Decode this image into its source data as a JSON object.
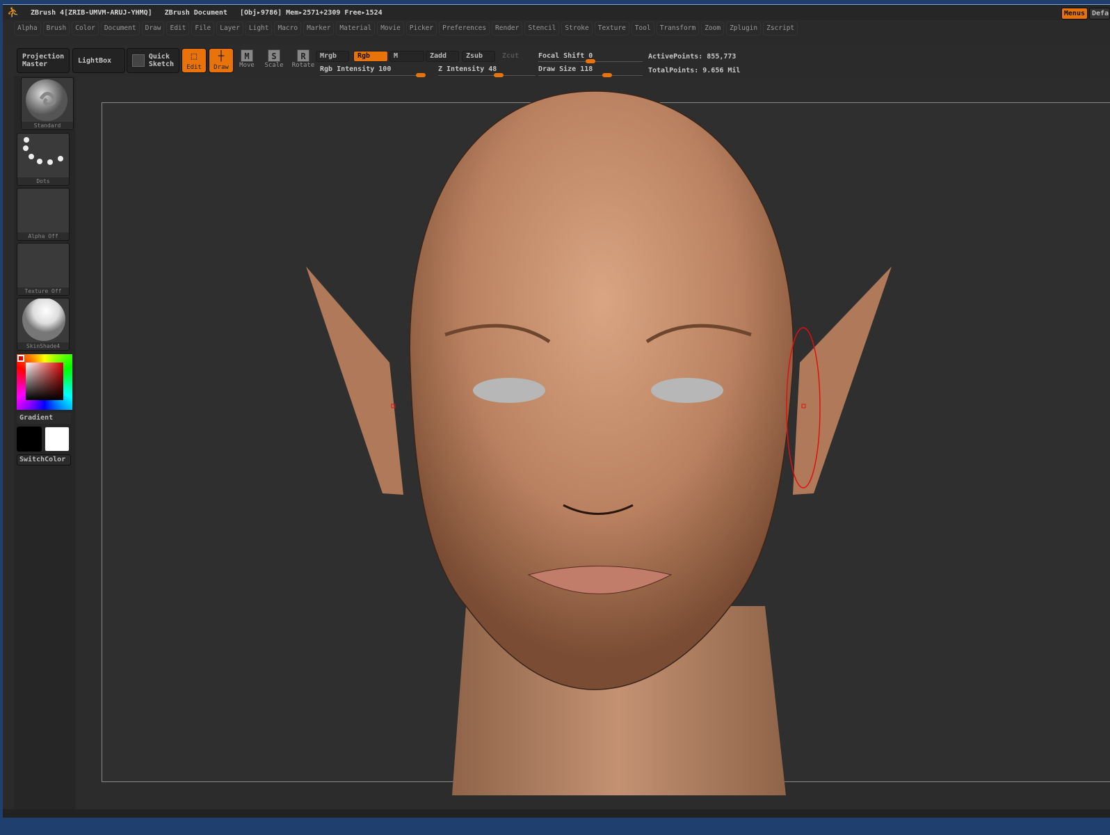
{
  "title": {
    "app": "ZBrush 4[ZRIB-UMVM-ARUJ-YHMQ]",
    "document": "ZBrush Document",
    "stats": "[Obj▸9786] Mem▸2571+2309 Free▸1524"
  },
  "menus": [
    "Alpha",
    "Brush",
    "Color",
    "Document",
    "Draw",
    "Edit",
    "File",
    "Layer",
    "Light",
    "Macro",
    "Marker",
    "Material",
    "Movie",
    "Picker",
    "Preferences",
    "Render",
    "Stencil",
    "Stroke",
    "Texture",
    "Tool",
    "Transform",
    "Zoom",
    "Zplugin",
    "Zscript"
  ],
  "top_right": {
    "menus": "Menus",
    "default": "DefaultZScript"
  },
  "toolbar": {
    "projection_master": [
      "Projection",
      "Master"
    ],
    "lightbox": "LightBox",
    "quick_sketch": [
      "Quick",
      "Sketch"
    ],
    "edit": "Edit",
    "draw": "Draw",
    "move": "Move",
    "scale": "Scale",
    "rotate": "Rotate",
    "mrgb": "Mrgb",
    "rgb": "Rgb",
    "m": "M",
    "zadd": "Zadd",
    "zsub": "Zsub",
    "zcut": "Zcut",
    "rgb_intensity": "Rgb Intensity 100",
    "z_intensity": "Z Intensity 48",
    "focal_shift": "Focal Shift 0",
    "draw_size": "Draw Size 118",
    "active_points": "ActivePoints: 855,773",
    "total_points": "TotalPoints: 9.656 Mil"
  },
  "sliders": {
    "rgb_intensity": 100,
    "z_intensity": 48,
    "focal_shift": 0,
    "draw_size": 118
  },
  "left": {
    "brush": "Standard",
    "stroke": "Dots",
    "alpha": "Alpha Off",
    "texture": "Texture Off",
    "material": "SkinShade4",
    "gradient": "Gradient",
    "switch_color": "SwitchColor"
  },
  "colors": {
    "accent": "#e8730a",
    "main_color": "#000000",
    "secondary_color": "#ffffff"
  }
}
